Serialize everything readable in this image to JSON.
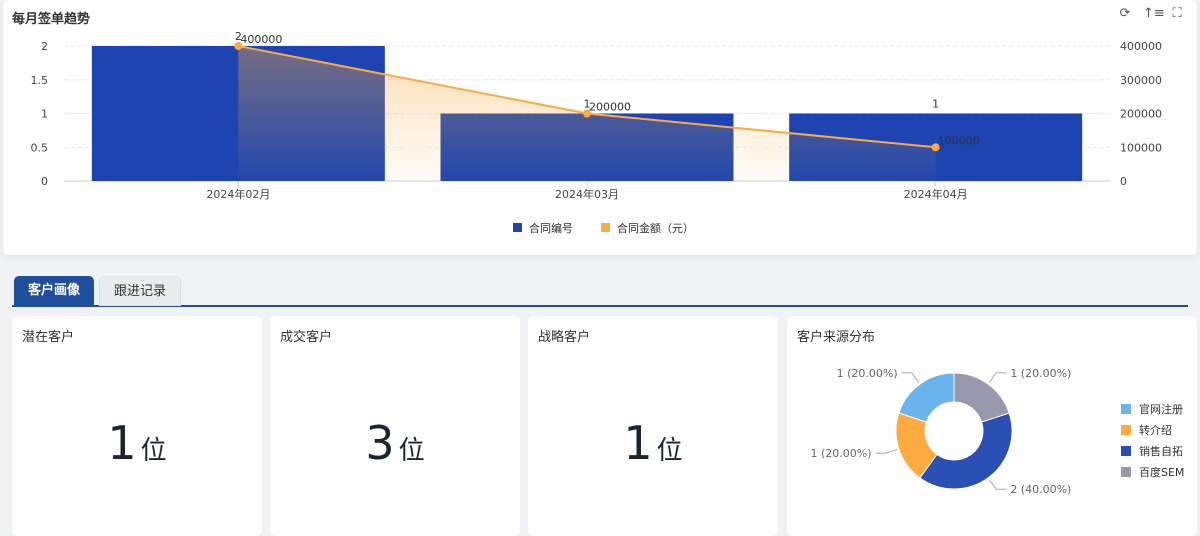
{
  "top_card": {
    "title": "每月签单趋势",
    "tools": [
      "refresh-icon",
      "sort-icon",
      "fullscreen-icon"
    ]
  },
  "chart_data": [
    {
      "type": "bar+line",
      "title": "每月签单趋势",
      "categories": [
        "2024年02月",
        "2024年03月",
        "2024年04月"
      ],
      "series": [
        {
          "name": "合同编号",
          "type": "bar",
          "values": [
            2,
            1,
            1
          ],
          "color": "#1d44b0"
        },
        {
          "name": "合同金额（元）",
          "type": "line",
          "values": [
            400000,
            200000,
            100000
          ],
          "color": "#fdaa40"
        }
      ],
      "yleft": {
        "ticks": [
          "0",
          "0.5",
          "1",
          "1.5",
          "2"
        ],
        "ylim": [
          0,
          2
        ]
      },
      "yright": {
        "ticks": [
          "0",
          "100000",
          "200000",
          "300000",
          "400000"
        ],
        "ylim": [
          0,
          400000
        ]
      },
      "legend": "bottom-center",
      "grid": true
    },
    {
      "type": "pie",
      "title": "客户来源分布",
      "labels": [
        "官网注册",
        "转介绍",
        "销售自拓",
        "百度SEM"
      ],
      "values": [
        1,
        1,
        2,
        1
      ],
      "data_labels": [
        "1 (20.00%)",
        "1 (20.00%)",
        "2 (40.00%)",
        "1 (20.00%)"
      ],
      "colors": [
        "#6ab4ec",
        "#fdaa40",
        "#2a4fb5",
        "#9a98ae"
      ],
      "legend": "right"
    }
  ],
  "tabs": [
    {
      "label": "客户画像"
    },
    {
      "label": "跟进记录"
    }
  ],
  "kpis": [
    {
      "title": "潜在客户",
      "value": "1",
      "unit": "位"
    },
    {
      "title": "成交客户",
      "value": "3",
      "unit": "位"
    },
    {
      "title": "战略客户",
      "value": "1",
      "unit": "位"
    }
  ]
}
